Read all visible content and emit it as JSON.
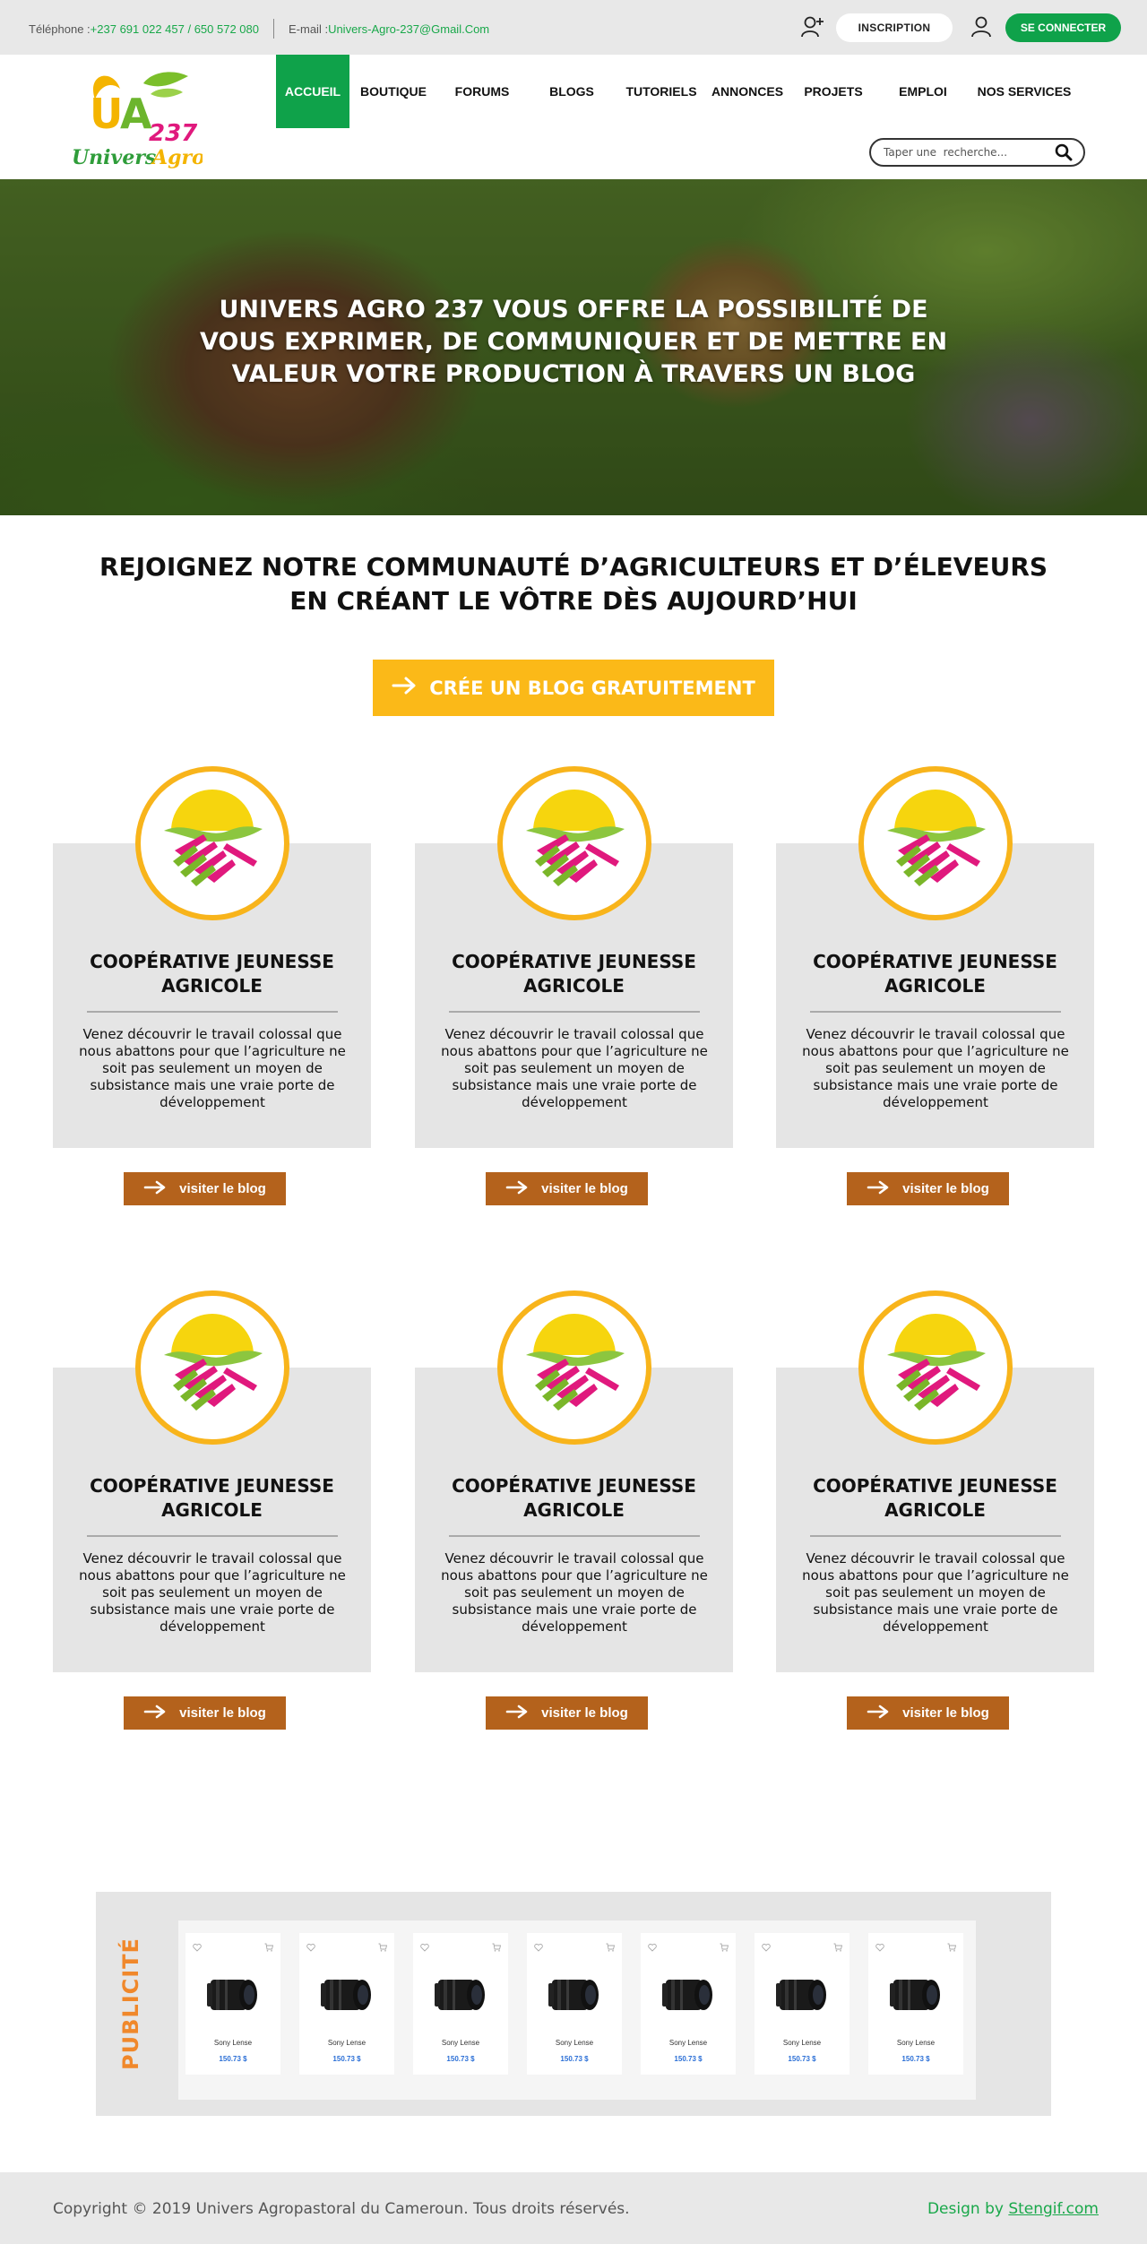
{
  "topbar": {
    "phone_label": "Téléphone : ",
    "phone_value": "+237 691 022 457 / 650 572 080",
    "email_label": "E-mail : ",
    "email_value": "Univers-Agro-237@Gmail.Com",
    "signup_label": "INSCRIPTION",
    "login_label": "SE CONNECTER"
  },
  "logo": {
    "letters": "UA",
    "number": "237",
    "name": "Univers Agro"
  },
  "nav": {
    "items": [
      "ACCUEIL",
      "BOUTIQUE",
      "FORUMS",
      "BLOGS",
      "TUTORIELS",
      "ANNONCES",
      "PROJETS",
      "EMPLOI",
      "NOS SERVICES"
    ],
    "active": "ACCUEIL"
  },
  "search": {
    "placeholder": "Taper une  recherche..."
  },
  "hero": {
    "title": "UNIVERS AGRO 237 VOUS OFFRE LA POSSIBILITÉ DE VOUS EXPRIMER, DE COMMUNIQUER ET DE METTRE EN VALEUR VOTRE PRODUCTION À TRAVERS UN BLOG"
  },
  "join": {
    "title": "REJOIGNEZ NOTRE COMMUNAUTÉ D’AGRICULTEURS ET D’ÉLEVEURS EN CRÉANT LE VÔTRE DÈS AUJOURD’HUI",
    "cta_label": "CRÉE UN BLOG GRATUITEMENT"
  },
  "cards": [
    {
      "title": "COOPÉRATIVE JEUNESSE AGRICOLE",
      "description": "Venez découvrir le travail colossal que nous abattons pour que l’agriculture ne soit pas seulement un moyen de subsistance mais une vraie porte de développement",
      "button": "visiter le blog"
    },
    {
      "title": "COOPÉRATIVE JEUNESSE AGRICOLE",
      "description": "Venez découvrir le travail colossal que nous abattons pour que l’agriculture ne soit pas seulement un moyen de subsistance mais une vraie porte de développement",
      "button": "visiter le blog"
    },
    {
      "title": "COOPÉRATIVE JEUNESSE AGRICOLE",
      "description": "Venez découvrir le travail colossal que nous abattons pour que l’agriculture ne soit pas seulement un moyen de subsistance mais une vraie porte de développement",
      "button": "visiter le blog"
    },
    {
      "title": "COOPÉRATIVE JEUNESSE AGRICOLE",
      "description": "Venez découvrir le travail colossal que nous abattons pour que l’agriculture ne soit pas seulement un moyen de subsistance mais une vraie porte de développement",
      "button": "visiter le blog"
    },
    {
      "title": "COOPÉRATIVE JEUNESSE AGRICOLE",
      "description": "Venez découvrir le travail colossal que nous abattons pour que l’agriculture ne soit pas seulement un moyen de subsistance mais une vraie porte de développement",
      "button": "visiter le blog"
    },
    {
      "title": "COOPÉRATIVE JEUNESSE AGRICOLE",
      "description": "Venez découvrir le travail colossal que nous abattons pour que l’agriculture ne soit pas seulement un moyen de subsistance mais une vraie porte de développement",
      "button": "visiter le blog"
    }
  ],
  "ads": {
    "label": "PUBLICITÉ",
    "products": [
      {
        "name": "Sony Lense",
        "price": "150.73 $"
      },
      {
        "name": "Sony Lense",
        "price": "150.73 $"
      },
      {
        "name": "Sony Lense",
        "price": "150.73 $"
      },
      {
        "name": "Sony Lense",
        "price": "150.73 $"
      },
      {
        "name": "Sony Lense",
        "price": "150.73 $"
      },
      {
        "name": "Sony Lense",
        "price": "150.73 $"
      },
      {
        "name": "Sony Lense",
        "price": "150.73 $"
      }
    ]
  },
  "footer": {
    "copyright": "Copyright © 2019 Univers Agropastoral du Cameroun. Tous droits réservés.",
    "design_prefix": "Design by ",
    "design_link": "Stengif.com"
  },
  "colors": {
    "brand_green": "#0fa24a",
    "cta_yellow": "#fbb918",
    "button_brown": "#b4621c",
    "ads_orange": "#f0882b",
    "emblem_ring": "#f8b41b"
  },
  "icons": [
    "user-add-icon",
    "user-icon",
    "search-icon",
    "arrow-right-icon",
    "heart-icon",
    "cart-icon",
    "camera-lens-icon",
    "handshake-emblem-icon"
  ]
}
